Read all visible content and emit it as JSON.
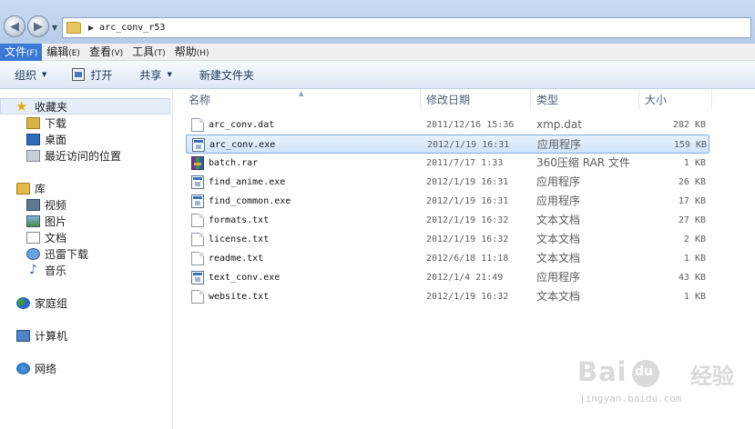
{
  "address": {
    "path": "arc_conv_r53"
  },
  "menu": [
    {
      "label": "文件",
      "key": "(F)"
    },
    {
      "label": "编辑",
      "key": "(E)"
    },
    {
      "label": "查看",
      "key": "(V)"
    },
    {
      "label": "工具",
      "key": "(T)"
    },
    {
      "label": "帮助",
      "key": "(H)"
    }
  ],
  "toolbar": {
    "organize": "组织",
    "open": "打开",
    "share": "共享",
    "new_folder": "新建文件夹"
  },
  "nav": {
    "favorites": "收藏夹",
    "downloads": "下载",
    "desktop": "桌面",
    "recent": "最近访问的位置",
    "library": "库",
    "video": "视频",
    "pictures": "图片",
    "documents": "文档",
    "xunlei": "迅雷下载",
    "music": "音乐",
    "homegroup": "家庭组",
    "computer": "计算机",
    "network": "网络"
  },
  "columns": {
    "name": "名称",
    "date": "修改日期",
    "type": "类型",
    "size": "大小"
  },
  "files": [
    {
      "name": "arc_conv.dat",
      "date": "2011/12/16 15:36",
      "type": "xmp.dat",
      "size": "282 KB",
      "icon": "doc"
    },
    {
      "name": "arc_conv.exe",
      "date": "2012/1/19 16:31",
      "type": "应用程序",
      "size": "159 KB",
      "icon": "exe"
    },
    {
      "name": "batch.rar",
      "date": "2011/7/17 1:33",
      "type": "360压缩 RAR 文件",
      "size": "1 KB",
      "icon": "rar"
    },
    {
      "name": "find_anime.exe",
      "date": "2012/1/19 16:31",
      "type": "应用程序",
      "size": "26 KB",
      "icon": "exe"
    },
    {
      "name": "find_common.exe",
      "date": "2012/1/19 16:31",
      "type": "应用程序",
      "size": "17 KB",
      "icon": "exe"
    },
    {
      "name": "formats.txt",
      "date": "2012/1/19 16:32",
      "type": "文本文档",
      "size": "27 KB",
      "icon": "doc"
    },
    {
      "name": "license.txt",
      "date": "2012/1/19 16:32",
      "type": "文本文档",
      "size": "2 KB",
      "icon": "doc"
    },
    {
      "name": "readme.txt",
      "date": "2012/6/18 11:18",
      "type": "文本文档",
      "size": "1 KB",
      "icon": "doc"
    },
    {
      "name": "text_conv.exe",
      "date": "2012/1/4 21:49",
      "type": "应用程序",
      "size": "43 KB",
      "icon": "exe"
    },
    {
      "name": "website.txt",
      "date": "2012/1/19 16:32",
      "type": "文本文档",
      "size": "1 KB",
      "icon": "doc"
    }
  ],
  "watermark": {
    "brand": "Bai",
    "brand_cn": "经验",
    "url": "jingyan.baidu.com"
  }
}
